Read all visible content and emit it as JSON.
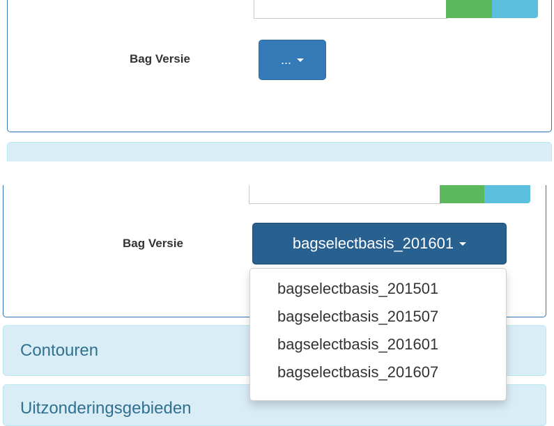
{
  "top_panel": {
    "label": "Bag Versie",
    "button_label": "..."
  },
  "bottom_panel": {
    "label": "Bag Versie",
    "selected_value": "bagselectbasis_201601",
    "dropdown_options": [
      "bagselectbasis_201501",
      "bagselectbasis_201507",
      "bagselectbasis_201601",
      "bagselectbasis_201607"
    ],
    "sections": [
      {
        "title": "Contouren"
      },
      {
        "title": "Uitzonderingsgebieden"
      }
    ]
  },
  "colors": {
    "primary": "#337ab7",
    "primary_active": "#286090",
    "success": "#5cb85c",
    "info": "#5bc0de",
    "accordion_bg": "#d9edf7",
    "accordion_text": "#31708f"
  }
}
